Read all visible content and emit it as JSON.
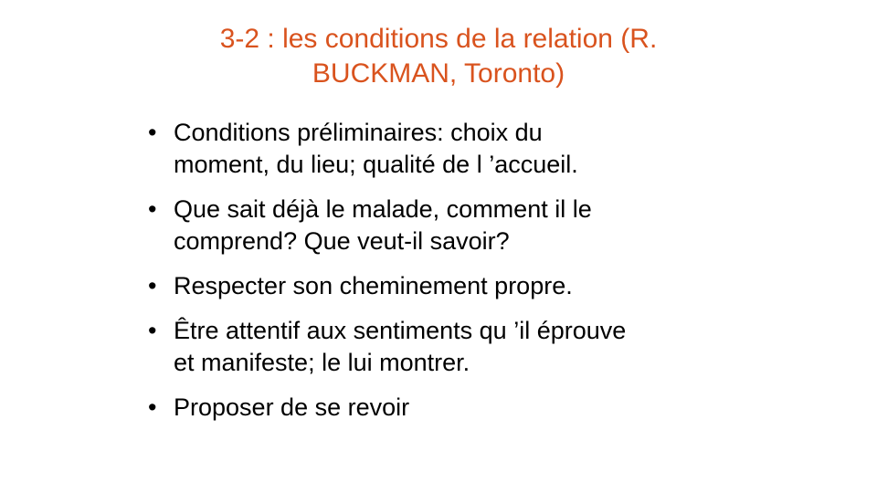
{
  "slide": {
    "title_lines": [
      "3-2 : les conditions de la relation (R.",
      "BUCKMAN, Toronto)"
    ],
    "bullet_symbol": "•",
    "bullets": [
      {
        "lines": [
          "Conditions préliminaires: choix du",
          "moment, du lieu; qualité de l ’accueil."
        ]
      },
      {
        "lines": [
          "Que sait déjà le malade, comment il le",
          "comprend? Que veut-il savoir?"
        ]
      },
      {
        "lines": [
          "Respecter son cheminement propre."
        ]
      },
      {
        "lines": [
          "Être attentif aux sentiments qu ’il éprouve",
          "et manifeste; le lui montrer."
        ]
      },
      {
        "lines": [
          "Proposer de se revoir"
        ]
      }
    ],
    "colors": {
      "title": "#d9531e",
      "body": "#000000",
      "background": "#ffffff"
    }
  }
}
